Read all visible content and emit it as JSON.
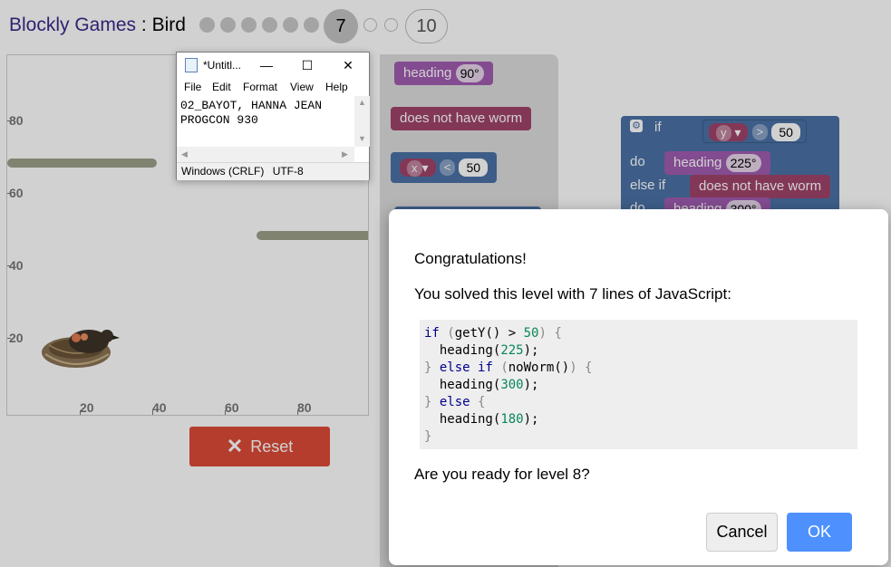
{
  "header": {
    "title_app": "Blockly Games",
    "title_sep": " : ",
    "title_game": "Bird",
    "current_level": "7",
    "last_level": "10"
  },
  "game": {
    "y_ticks": [
      "80",
      "60",
      "40",
      "20"
    ],
    "x_ticks": [
      "20",
      "40",
      "60",
      "80"
    ],
    "reset_label": "Reset"
  },
  "toolbox": {
    "heading_label": "heading",
    "heading_value": "90°",
    "no_worm_label": "does not have worm",
    "compare_var": "x",
    "compare_op": "<",
    "compare_value": "50"
  },
  "workspace": {
    "if_label": "if",
    "var": "y",
    "op": ">",
    "value": "50",
    "do_label": "do",
    "heading_label": "heading",
    "heading_value_1": "225°",
    "else_if_label": "else if",
    "no_worm_label": "does not have worm",
    "heading_value_2": "300°"
  },
  "notepad": {
    "title": "*Untitl...",
    "menu": [
      "File",
      "Edit",
      "Format",
      "View",
      "Help"
    ],
    "content_line1": "02_BAYOT, HANNA JEAN",
    "content_line2": "PROGCON 930",
    "status_eol": "Windows (CRLF)",
    "status_enc": "UTF-8"
  },
  "dialog": {
    "congrats": "Congratulations!",
    "solved": "You solved this level with 7 lines of JavaScript:",
    "code": {
      "l1_kw": "if",
      "l1_fn": "getY()",
      "l1_op": " > ",
      "l1_num": "50",
      "l2_fn": "heading",
      "l2_num": "225",
      "l3_kw1": "else if",
      "l3_fn": "noWorm()",
      "l4_fn": "heading",
      "l4_num": "300",
      "l5_kw": "else",
      "l6_fn": "heading",
      "l6_num": "180"
    },
    "question": "Are you ready for level 8?",
    "cancel_label": "Cancel",
    "ok_label": "OK"
  }
}
